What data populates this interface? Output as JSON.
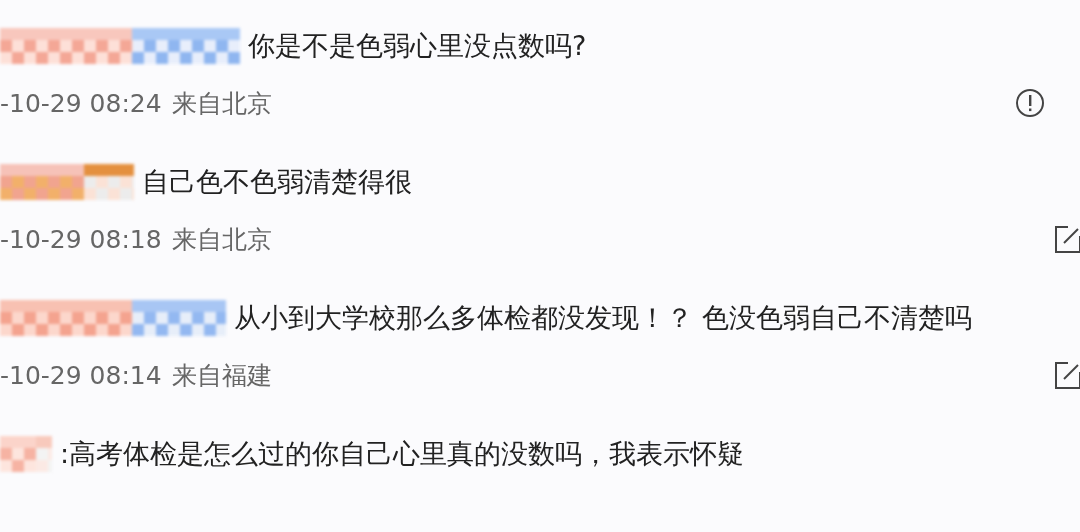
{
  "comments": [
    {
      "text": "你是不是色弱心里没点数吗?",
      "date": "-10-29 08:24",
      "location": "来自北京",
      "action_icon": {
        "kind": "report"
      }
    },
    {
      "text": "自己色不色弱清楚得很",
      "date": "-10-29 08:18",
      "location": "来自北京",
      "action_icon": {
        "kind": "share"
      }
    },
    {
      "text": "从小到大学校那么多体检都没发现！？ 色没色弱自己不清楚吗",
      "date": "-10-29 08:14",
      "location": "来自福建",
      "action_icon": {
        "kind": "share"
      }
    },
    {
      "text": ":高考体检是怎么过的你自己心里真的没数吗，我表示怀疑"
    }
  ]
}
